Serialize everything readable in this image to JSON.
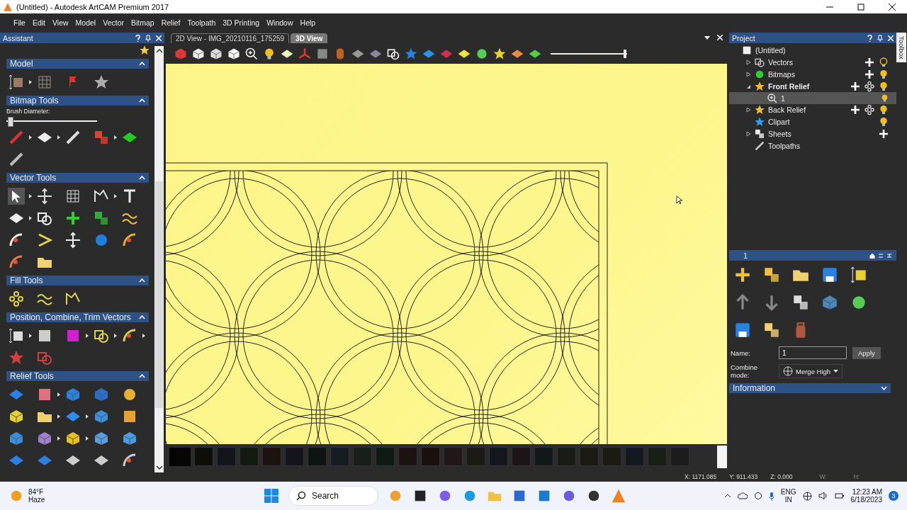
{
  "window": {
    "title": "(Untitled) - Autodesk ArtCAM Premium 2017"
  },
  "menu": [
    "File",
    "Edit",
    "View",
    "Model",
    "Vector",
    "Bitmap",
    "Relief",
    "Toolpath",
    "3D Printing",
    "Window",
    "Help"
  ],
  "assistant": {
    "title": "Assistant",
    "sections": [
      {
        "title": "Model",
        "expanded": true
      },
      {
        "title": "Bitmap Tools",
        "expanded": true,
        "slider": {
          "label": "Brush Diameter:",
          "level": 0.02
        }
      },
      {
        "title": "Vector Tools",
        "expanded": true
      },
      {
        "title": "Fill Tools",
        "expanded": true
      },
      {
        "title": "Position, Combine, Trim Vectors",
        "expanded": true
      },
      {
        "title": "Relief Tools",
        "expanded": true
      }
    ]
  },
  "view_tabs": [
    {
      "label": "2D View - IMG_20210116_175259",
      "selected": false
    },
    {
      "label": "3D View",
      "selected": true
    }
  ],
  "view_toolbar": {
    "slider": {
      "level": 1
    }
  },
  "palette": [
    {
      "color": "#0d0d0a"
    },
    {
      "color": "#14141c"
    },
    {
      "color": "#121a12"
    },
    {
      "color": "#1c1210"
    },
    {
      "color": "#15141d"
    },
    {
      "color": "#0f1412"
    },
    {
      "color": "#161c22"
    },
    {
      "color": "#1a1e1a"
    },
    {
      "color": "#101a14"
    },
    {
      "color": "#1c1212"
    },
    {
      "color": "#1a1010"
    },
    {
      "color": "#201818"
    },
    {
      "color": "#1a1a16"
    },
    {
      "color": "#16161e"
    },
    {
      "color": "#1e1418"
    },
    {
      "color": "#121818"
    },
    {
      "color": "#181c14"
    },
    {
      "color": "#1a1a12"
    },
    {
      "color": "#1c1a14"
    },
    {
      "color": "#141820"
    },
    {
      "color": "#181e18"
    },
    {
      "color": "#1c1c1c"
    }
  ],
  "status_bar": {
    "x": "X: 1171.085",
    "y": "Y: 911.433",
    "z": "Z: 0.000",
    "w": "W:",
    "h": "H:"
  },
  "project": {
    "title": "Project",
    "tree": [
      {
        "label": "(Untitled)",
        "active": false,
        "selected": false,
        "children": [
          {
            "label": "Vectors",
            "expanded": false,
            "active": false,
            "selected": false,
            "visible": false
          },
          {
            "label": "Bitmaps",
            "expanded": false,
            "active": false,
            "selected": false,
            "visible": true
          },
          {
            "label": "Front Relief",
            "expanded": true,
            "active": true,
            "selected": false,
            "visible": true,
            "children": [
              {
                "label": "1",
                "active": false,
                "selected": true,
                "visible": true
              }
            ]
          },
          {
            "label": "Back Relief",
            "expanded": false,
            "active": false,
            "selected": false,
            "visible": true
          },
          {
            "label": "Clipart",
            "active": false,
            "selected": false,
            "visible": true
          },
          {
            "label": "Sheets",
            "expanded": false,
            "active": false,
            "selected": false
          },
          {
            "label": "Toolpaths",
            "active": false,
            "selected": false
          }
        ]
      }
    ]
  },
  "toolbox_tab": "Toolbox",
  "layer_panel": {
    "title": "1",
    "name_label": "Name:",
    "name_value": "1",
    "apply": "Apply",
    "combine_label": "Combine mode:",
    "combine_value": "Merge High",
    "information": {
      "title": "Information",
      "expanded": false
    }
  },
  "taskbar": {
    "temperature": "84°F",
    "condition": "Haze",
    "search": "Search",
    "language": "ENG",
    "region": "IN",
    "time": "12:23 AM",
    "date": "6/18/2023",
    "badge": "3"
  }
}
